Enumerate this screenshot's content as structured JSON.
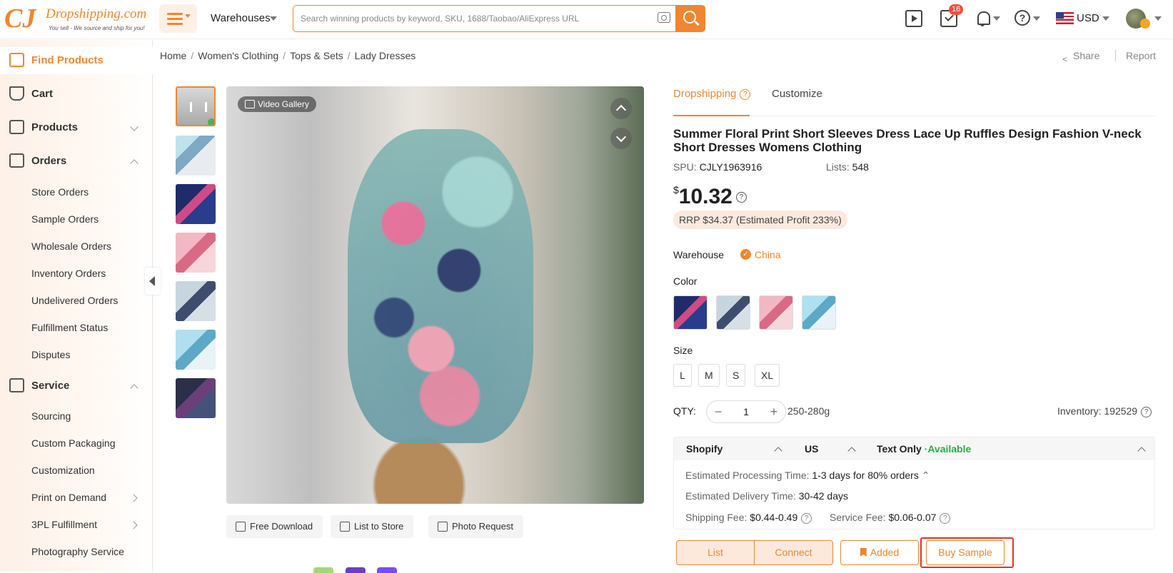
{
  "brand": {
    "logo_mark": "CJ",
    "name": "Dropshipping.com",
    "tagline": "You sell - We source and ship for you!"
  },
  "header": {
    "warehouses_label": "Warehouses",
    "search_placeholder": "Search winning products by keyword, SKU, 1688/Taobao/AliExpress URL",
    "tasks_badge": "16",
    "currency": "USD",
    "accent_color": "#f0862f"
  },
  "sidebar": {
    "find_products": "Find Products",
    "cart": "Cart",
    "products": "Products",
    "orders": "Orders",
    "orders_sub": [
      "Store Orders",
      "Sample Orders",
      "Wholesale Orders",
      "Inventory Orders",
      "Undelivered Orders",
      "Fulfillment Status",
      "Disputes"
    ],
    "service": "Service",
    "service_sub": [
      "Sourcing",
      "Custom Packaging",
      "Customization",
      "Print on Demand",
      "3PL Fulfillment",
      "Photography Service"
    ]
  },
  "breadcrumb": [
    "Home",
    "Women's Clothing",
    "Tops & Sets",
    "Lady Dresses"
  ],
  "page_actions": {
    "share": "Share",
    "report": "Report"
  },
  "gallery": {
    "video_gallery_label": "Video Gallery",
    "actions": [
      "Free Download",
      "List to Store",
      "Photo Request"
    ]
  },
  "product": {
    "tabs": [
      "Dropshipping",
      "Customize"
    ],
    "title": "Summer Floral Print Short Sleeves Dress Lace Up Ruffles Design Fashion V-neck Short Dresses Womens Clothing",
    "spu_label": "SPU:",
    "spu": "CJLY1963916",
    "lists_label": "Lists:",
    "lists": "548",
    "currency_symbol": "$",
    "price": "10.32",
    "rrp_text": "RRP $34.37 (Estimated Profit 233%)",
    "warehouse_label": "Warehouse",
    "warehouse": "China",
    "color_label": "Color",
    "size_label": "Size",
    "sizes": [
      "L",
      "M",
      "S",
      "XL"
    ],
    "qty_label": "QTY:",
    "qty": "1",
    "weight": "250-280g",
    "inventory_label": "Inventory:",
    "inventory": "192529"
  },
  "shipping": {
    "store": "Shopify",
    "country": "US",
    "method": "Text Only",
    "availability": "·Available",
    "processing_label": "Estimated Processing Time:",
    "processing": "1-3 days for 80% orders",
    "delivery_label": "Estimated Delivery Time:",
    "delivery": "30-42 days",
    "shipping_fee_label": "Shipping Fee:",
    "shipping_fee": "$0.44-0.49",
    "service_fee_label": "Service Fee:",
    "service_fee": "$0.06-0.07"
  },
  "buttons": {
    "list": "List",
    "connect": "Connect",
    "added": "Added",
    "buy_sample": "Buy Sample"
  }
}
